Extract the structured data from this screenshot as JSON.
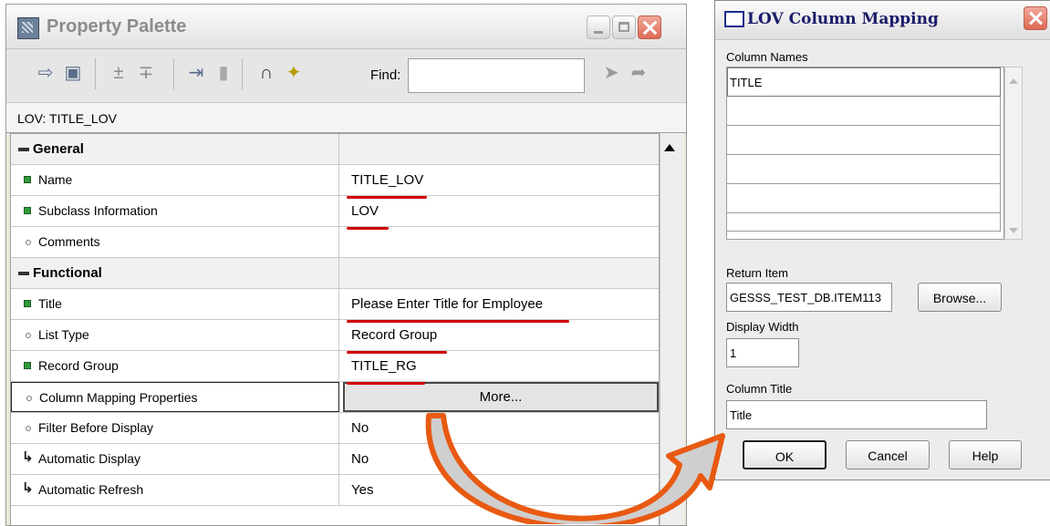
{
  "palette": {
    "title": "Property Palette",
    "find_label": "Find:",
    "find_value": "",
    "subheader": "LOV: TITLE_LOV",
    "rows": [
      {
        "kind": "group",
        "label": "General",
        "value": ""
      },
      {
        "kind": "prop",
        "marker": "green",
        "label": "Name",
        "value": "TITLE_LOV"
      },
      {
        "kind": "prop",
        "marker": "green",
        "label": "Subclass Information",
        "value": "LOV"
      },
      {
        "kind": "prop",
        "marker": "dot",
        "label": "Comments",
        "value": ""
      },
      {
        "kind": "group",
        "label": "Functional",
        "value": ""
      },
      {
        "kind": "prop",
        "marker": "green",
        "label": "Title",
        "value": "Please Enter Title for Employee"
      },
      {
        "kind": "prop",
        "marker": "dot",
        "label": "List Type",
        "value": "Record Group"
      },
      {
        "kind": "prop",
        "marker": "green",
        "label": "Record Group",
        "value": "TITLE_RG"
      },
      {
        "kind": "button",
        "marker": "dot",
        "label": "Column Mapping Properties",
        "value": "More..."
      },
      {
        "kind": "prop",
        "marker": "dot",
        "label": "Filter Before Display",
        "value": "No"
      },
      {
        "kind": "prop",
        "marker": "inherit",
        "label": "Automatic Display",
        "value": "No"
      },
      {
        "kind": "prop",
        "marker": "inherit",
        "label": "Automatic Refresh",
        "value": "Yes"
      }
    ]
  },
  "lov_dialog": {
    "title": "LOV Column Mapping",
    "column_names_label": "Column Names",
    "column_names": [
      "TITLE",
      "",
      "",
      "",
      "",
      ""
    ],
    "return_item_label": "Return Item",
    "return_item_value": "GESSS_TEST_DB.ITEM113",
    "browse_label": "Browse...",
    "display_width_label": "Display Width",
    "display_width_value": "1",
    "column_title_label": "Column Title",
    "column_title_value": "Title",
    "ok_label": "OK",
    "cancel_label": "Cancel",
    "help_label": "Help"
  },
  "colors": {
    "highlight_underline": "#d20000",
    "arrow_orange": "#e85a12",
    "arrow_fill": "#cfcfcf"
  }
}
